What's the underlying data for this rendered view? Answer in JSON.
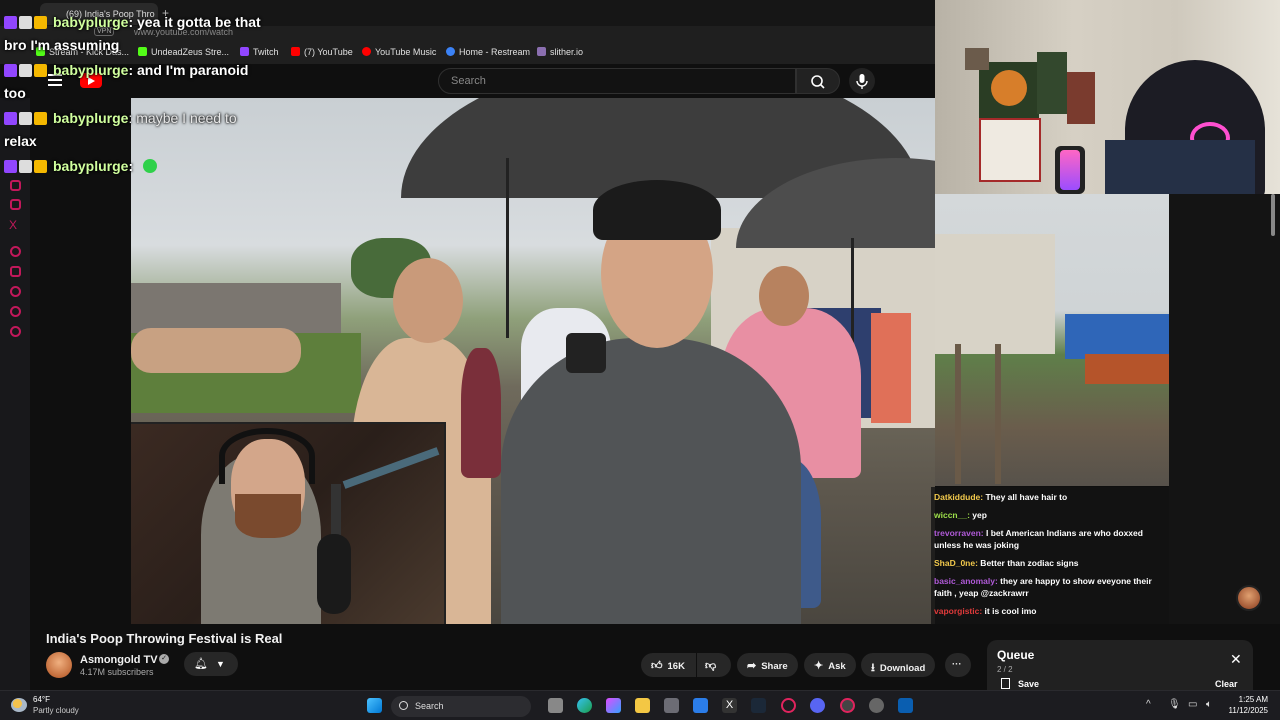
{
  "browser": {
    "tab_title": "(69) India's Poop Thro",
    "url": "www.youtube.com/watch",
    "vpn_label": "VPN",
    "bookmarks": [
      "Stream - Kick Das...",
      "UndeadZeus Stre...",
      "Twitch",
      "(7) YouTube",
      "YouTube Music",
      "Home - Restream",
      "slither.io"
    ]
  },
  "youtube": {
    "search_placeholder": "Search"
  },
  "overlay_chat": [
    {
      "user": "babyplurge",
      "message": ": yea it gotta be that",
      "wrap": "bro I'm assuming"
    },
    {
      "user": "babyplurge",
      "message": ": and I'm paranoid",
      "wrap": "too"
    },
    {
      "user": "babyplurge",
      "message": ": maybe I need to",
      "wrap": "relax"
    },
    {
      "user": "babyplurge",
      "message": ":"
    }
  ],
  "stream_chat": [
    {
      "user": "Datkiddude:",
      "message": " They all have hair to",
      "color": "#f2c94c"
    },
    {
      "user": "wiccn__:",
      "message": " yep",
      "color": "#9ee04a"
    },
    {
      "user": "trevorraven:",
      "message": " I bet American Indians are who doxxed unless he was joking",
      "color": "#b05ad8"
    },
    {
      "user": "ShaD_0ne:",
      "message": " Better than zodiac signs",
      "color": "#f2c94c"
    },
    {
      "user": "basic_anomaly:",
      "message": " they are happy to show eveyone their faith , yeap @zackrawrr",
      "color": "#b05ad8"
    },
    {
      "user": "vaporgistic:",
      "message": " it is cool imo",
      "color": "#e03a3a"
    }
  ],
  "video": {
    "title": "India's Poop Throwing Festival is Real",
    "channel": "Asmongold TV",
    "subscribers": "4.17M subscribers",
    "likes": "16K",
    "share_label": "Share",
    "ask_label": "Ask",
    "download_label": "Download",
    "more_label": "···"
  },
  "queue": {
    "title": "Queue",
    "count": "2 / 2",
    "save_label": "Save",
    "clear_label": "Clear"
  },
  "taskbar": {
    "temp": "64°F",
    "weather": "Partly cloudy",
    "search_label": "Search",
    "time": "1:25 AM",
    "date": "11/12/2025"
  },
  "colors": {
    "youtube_red": "#ff0000",
    "chat_username": "#d0ff9e",
    "twitch_purple": "#9146ff"
  }
}
